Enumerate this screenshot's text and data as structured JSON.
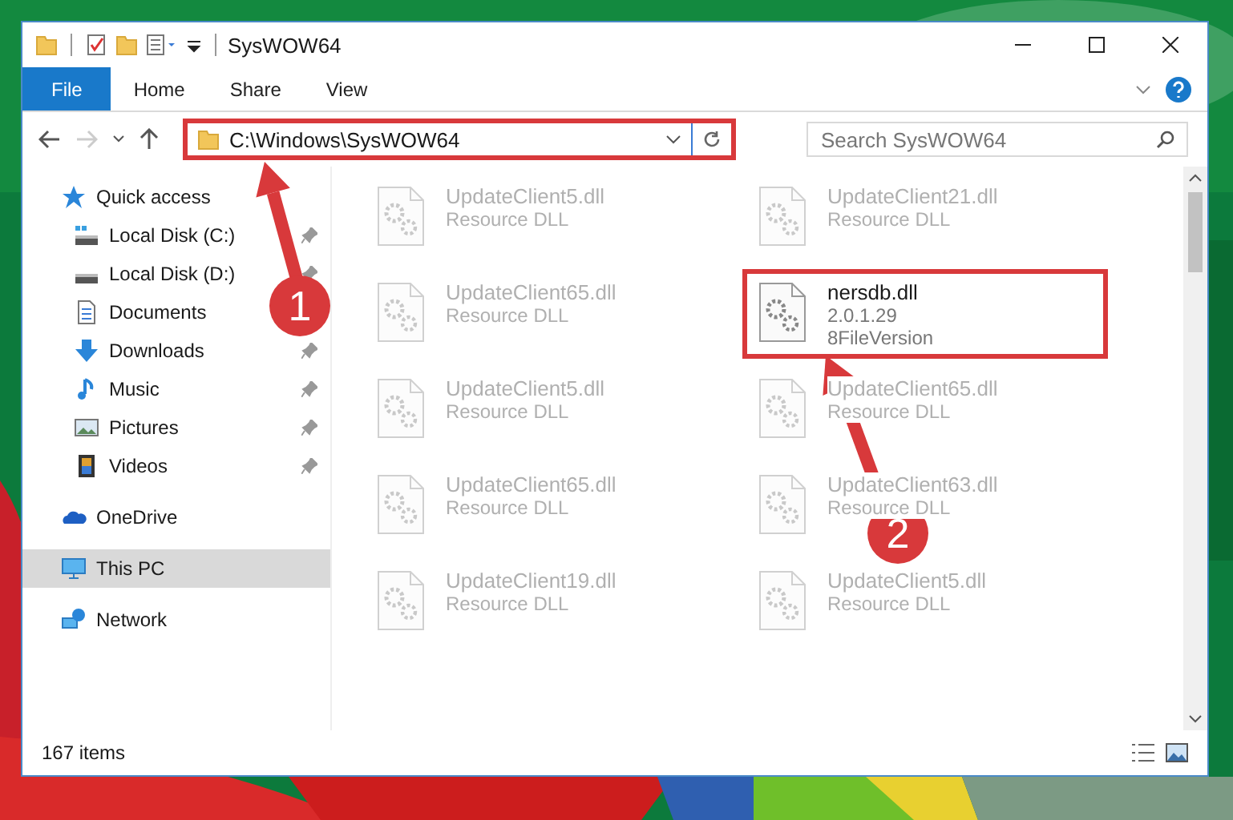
{
  "window": {
    "title": "SysWOW64"
  },
  "ribbon_tabs": [
    {
      "label": "File",
      "selected": true
    },
    {
      "label": "Home",
      "selected": false
    },
    {
      "label": "Share",
      "selected": false
    },
    {
      "label": "View",
      "selected": false
    }
  ],
  "address_bar": {
    "path": "C:\\Windows\\SysWOW64",
    "highlighted": true
  },
  "search": {
    "placeholder": "Search SysWOW64"
  },
  "sidebar": {
    "items": [
      {
        "label": "Quick access",
        "selected": false,
        "pinned": false,
        "children": [
          {
            "label": "Local Disk (C:)",
            "selected": false,
            "pinned": true
          },
          {
            "label": "Local Disk (D:)",
            "selected": false,
            "pinned": true
          },
          {
            "label": "Documents",
            "selected": false,
            "pinned": false
          },
          {
            "label": "Downloads",
            "selected": false,
            "pinned": true
          },
          {
            "label": "Music",
            "selected": false,
            "pinned": true
          },
          {
            "label": "Pictures",
            "selected": false,
            "pinned": true
          },
          {
            "label": "Videos",
            "selected": false,
            "pinned": true
          }
        ]
      },
      {
        "label": "OneDrive",
        "selected": false,
        "pinned": false
      },
      {
        "label": "This PC",
        "selected": true,
        "pinned": false
      },
      {
        "label": "Network",
        "selected": false,
        "pinned": false
      }
    ]
  },
  "files": [
    {
      "name": "UpdateClient5.dll",
      "details": [
        "Resource DLL"
      ],
      "faded": true,
      "highlighted": false
    },
    {
      "name": "UpdateClient21.dll",
      "details": [
        "Resource DLL"
      ],
      "faded": true,
      "highlighted": false
    },
    {
      "name": "UpdateClient65.dll",
      "details": [
        "Resource DLL"
      ],
      "faded": true,
      "highlighted": false
    },
    {
      "name": "nersdb.dll",
      "details": [
        "2.0.1.29",
        "8FileVersion"
      ],
      "faded": false,
      "highlighted": true
    },
    {
      "name": "UpdateClient5.dll",
      "details": [
        "Resource DLL"
      ],
      "faded": true,
      "highlighted": false
    },
    {
      "name": "UpdateClient65.dll",
      "details": [
        "Resource DLL"
      ],
      "faded": true,
      "highlighted": false
    },
    {
      "name": "UpdateClient65.dll",
      "details": [
        "Resource DLL"
      ],
      "faded": true,
      "highlighted": false
    },
    {
      "name": "UpdateClient63.dll",
      "details": [
        "Resource DLL"
      ],
      "faded": true,
      "highlighted": false
    },
    {
      "name": "UpdateClient19.dll",
      "details": [
        "Resource DLL"
      ],
      "faded": true,
      "highlighted": false
    },
    {
      "name": "UpdateClient5.dll",
      "details": [
        "Resource DLL"
      ],
      "faded": true,
      "highlighted": false
    }
  ],
  "status_bar": {
    "item_count": "167 items"
  },
  "annotations": [
    {
      "label": "1"
    },
    {
      "label": "2"
    }
  ]
}
